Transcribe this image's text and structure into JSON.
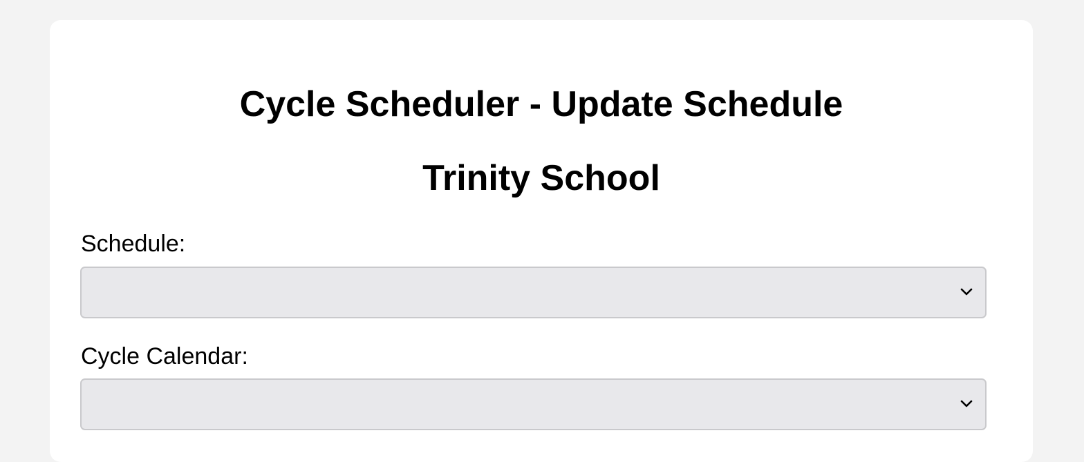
{
  "header": {
    "title": "Cycle Scheduler - Update Schedule",
    "school": "Trinity School"
  },
  "form": {
    "schedule": {
      "label": "Schedule:",
      "value": "",
      "icon": "chevron-down-icon"
    },
    "cycle_calendar": {
      "label": "Cycle Calendar:",
      "value": "",
      "icon": "chevron-down-icon"
    }
  }
}
